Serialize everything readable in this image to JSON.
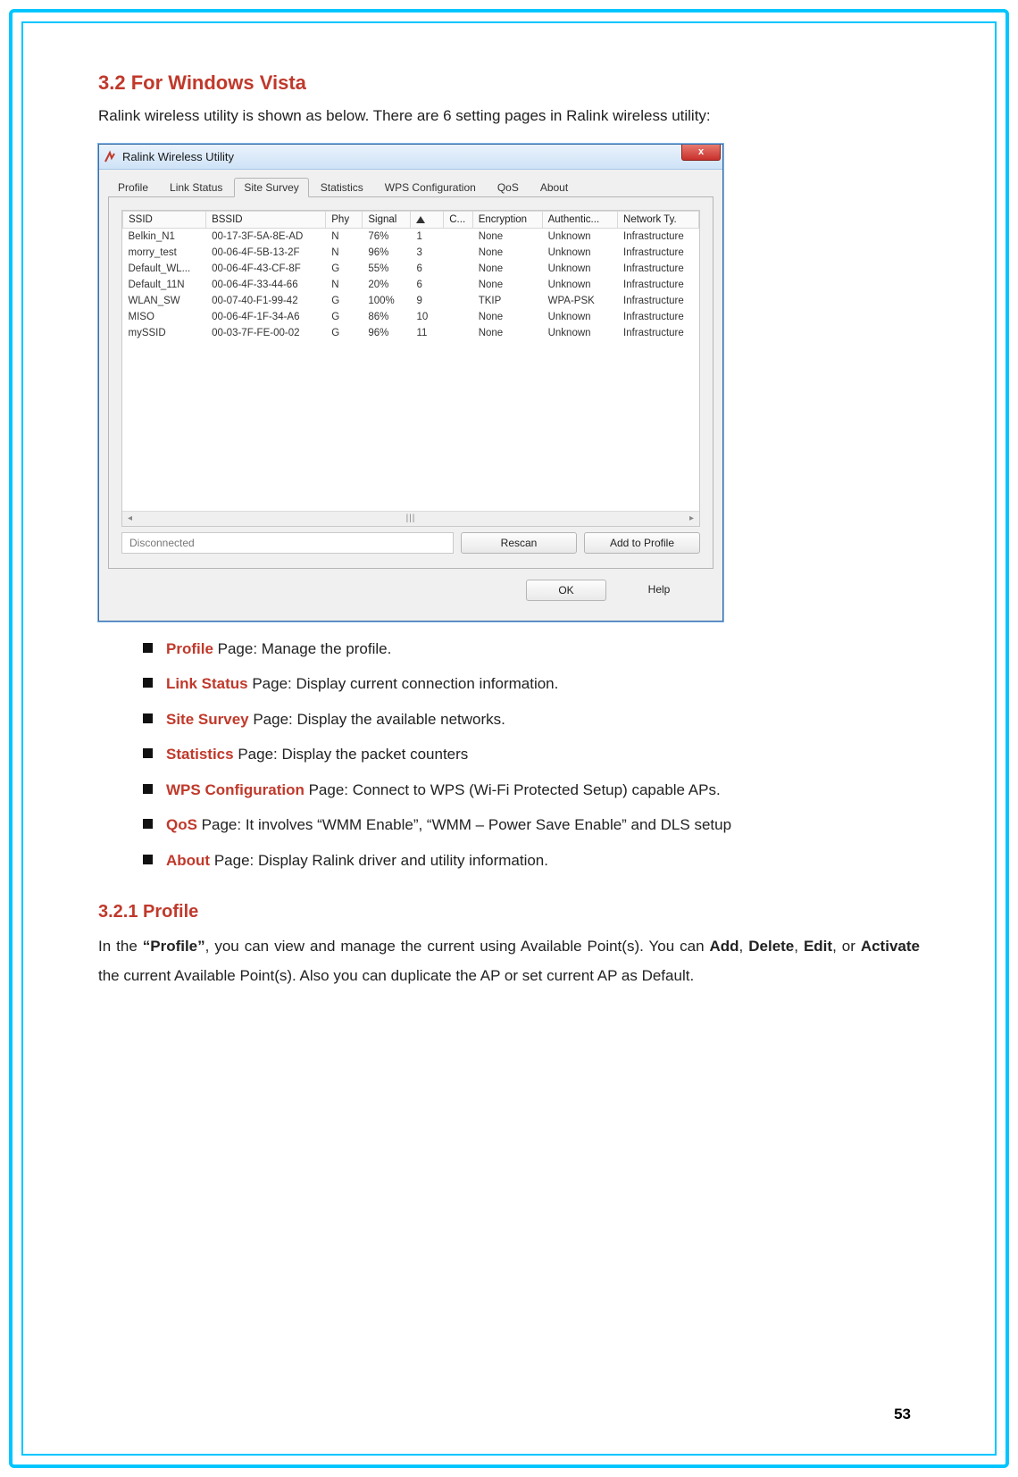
{
  "section": {
    "heading": "3.2 For Windows Vista",
    "intro": "Ralink wireless utility is shown as below. There are 6 setting pages in Ralink wireless utility:"
  },
  "window": {
    "title": "Ralink Wireless Utility",
    "close_label": "x",
    "tabs": [
      "Profile",
      "Link Status",
      "Site Survey",
      "Statistics",
      "WPS Configuration",
      "QoS",
      "About"
    ],
    "active_tab_index": 2,
    "columns": [
      "SSID",
      "BSSID",
      "Phy",
      "Signal",
      "▲",
      "C...",
      "Encryption",
      "Authentic...",
      "Network Ty."
    ],
    "rows": [
      {
        "ssid": "Belkin_N1",
        "bssid": "00-17-3F-5A-8E-AD",
        "phy": "N",
        "signal": "76%",
        "sort": "1",
        "c": "",
        "enc": "None",
        "auth": "Unknown",
        "net": "Infrastructure"
      },
      {
        "ssid": "morry_test",
        "bssid": "00-06-4F-5B-13-2F",
        "phy": "N",
        "signal": "96%",
        "sort": "3",
        "c": "",
        "enc": "None",
        "auth": "Unknown",
        "net": "Infrastructure"
      },
      {
        "ssid": "Default_WL...",
        "bssid": "00-06-4F-43-CF-8F",
        "phy": "G",
        "signal": "55%",
        "sort": "6",
        "c": "",
        "enc": "None",
        "auth": "Unknown",
        "net": "Infrastructure"
      },
      {
        "ssid": "Default_11N",
        "bssid": "00-06-4F-33-44-66",
        "phy": "N",
        "signal": "20%",
        "sort": "6",
        "c": "",
        "enc": "None",
        "auth": "Unknown",
        "net": "Infrastructure"
      },
      {
        "ssid": "WLAN_SW",
        "bssid": "00-07-40-F1-99-42",
        "phy": "G",
        "signal": "100%",
        "sort": "9",
        "c": "",
        "enc": "TKIP",
        "auth": "WPA-PSK",
        "net": "Infrastructure"
      },
      {
        "ssid": "MISO",
        "bssid": "00-06-4F-1F-34-A6",
        "phy": "G",
        "signal": "86%",
        "sort": "10",
        "c": "",
        "enc": "None",
        "auth": "Unknown",
        "net": "Infrastructure"
      },
      {
        "ssid": "mySSID",
        "bssid": "00-03-7F-FE-00-02",
        "phy": "G",
        "signal": "96%",
        "sort": "11",
        "c": "",
        "enc": "None",
        "auth": "Unknown",
        "net": "Infrastructure"
      }
    ],
    "status": "Disconnected",
    "rescan_label": "Rescan",
    "add_profile_label": "Add to Profile",
    "ok_label": "OK",
    "help_label": "Help"
  },
  "bullets": [
    {
      "kw": "Profile",
      "rest": " Page: Manage the profile."
    },
    {
      "kw": "Link Status",
      "rest": " Page: Display current connection information."
    },
    {
      "kw": "Site Survey",
      "rest": " Page: Display the available networks."
    },
    {
      "kw": "Statistics",
      "rest": " Page: Display the packet counters"
    },
    {
      "kw": "WPS Configuration",
      "rest": " Page: Connect to WPS (Wi-Fi Protected Setup) capable APs."
    },
    {
      "kw": "QoS",
      "rest": " Page: It involves “WMM Enable”, “WMM – Power Save Enable” and DLS setup"
    },
    {
      "kw": "About",
      "rest": " Page: Display Ralink driver and utility information."
    }
  ],
  "subsection": {
    "heading": "3.2.1   Profile",
    "prefix": "In the ",
    "quote": "“Profile”",
    "mid1": ", you can view and manage the current using Available Point(s). You can ",
    "b1": "Add",
    "sep1": ", ",
    "b2": "Delete",
    "sep2": ", ",
    "b3": "Edit",
    "sep3": ", or ",
    "b4": "Activate",
    "tail": " the current Available Point(s). Also you can duplicate the AP or set current AP as Default."
  },
  "page_number": "53"
}
